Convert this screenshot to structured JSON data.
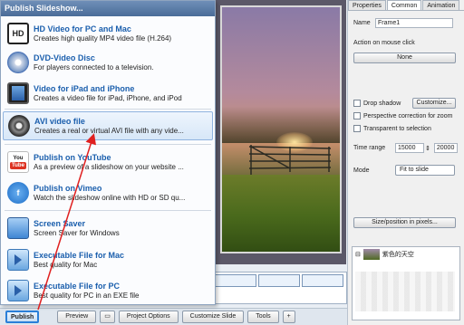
{
  "menu": {
    "title": "Publish Slideshow...",
    "items": [
      {
        "title": "HD Video for PC and Mac",
        "desc": "Creates high quality MP4 video file (H.264)",
        "icon": "hd-video-icon"
      },
      {
        "title": "DVD-Video Disc",
        "desc": "For players connected to a television.",
        "icon": "dvd-disc-icon"
      },
      {
        "title": "Video for iPad and iPhone",
        "desc": "Creates a video file for iPad, iPhone, and iPod",
        "icon": "ipad-iphone-icon"
      },
      {
        "title": "AVI video file",
        "desc": "Creates a real or virtual AVI file with any vide...",
        "icon": "avi-film-icon"
      },
      {
        "title": "Publish on YouTube",
        "desc": "As a preview of a slideshow on your website ...",
        "icon": "youtube-icon"
      },
      {
        "title": "Publish on Vimeo",
        "desc": "Watch the slideshow online with HD or SD qu...",
        "icon": "vimeo-icon"
      },
      {
        "title": "Screen Saver",
        "desc": "Screen Saver for Windows",
        "icon": "screen-saver-icon"
      },
      {
        "title": "Executable File for Mac",
        "desc": "Best quality for Mac",
        "icon": "mac-executable-icon"
      },
      {
        "title": "Executable File for PC",
        "desc": "Best quality for PC in an EXE file",
        "icon": "pc-executable-icon"
      }
    ]
  },
  "panel": {
    "tabs": [
      "Properties",
      "Common",
      "Animation"
    ],
    "name_label": "Name",
    "name_value": "Frame1",
    "action_label": "Action on mouse click",
    "action_value": "None",
    "drop_shadow": "Drop shadow",
    "customize": "Customize...",
    "perspective": "Perspective correction for zoom",
    "transparent": "Transparent to selection",
    "time_range_label": "Time range",
    "time_start": "15000",
    "time_end": "20000",
    "mode_label": "Mode",
    "mode_value": "Fit to slide",
    "size_position": "Size/position in pixels...",
    "tree_item": "紫色的天空"
  },
  "toolbar": {
    "publish": "Publish",
    "preview": "Preview",
    "project_options": "Project Options",
    "customize_slide": "Customize Slide",
    "tools": "Tools",
    "plus": "+"
  },
  "colors": {
    "menu_title_bg": "#4a6c98",
    "item_title": "#1b5fad",
    "arrow": "#e02020",
    "publish_border": "#2b7fd8"
  }
}
